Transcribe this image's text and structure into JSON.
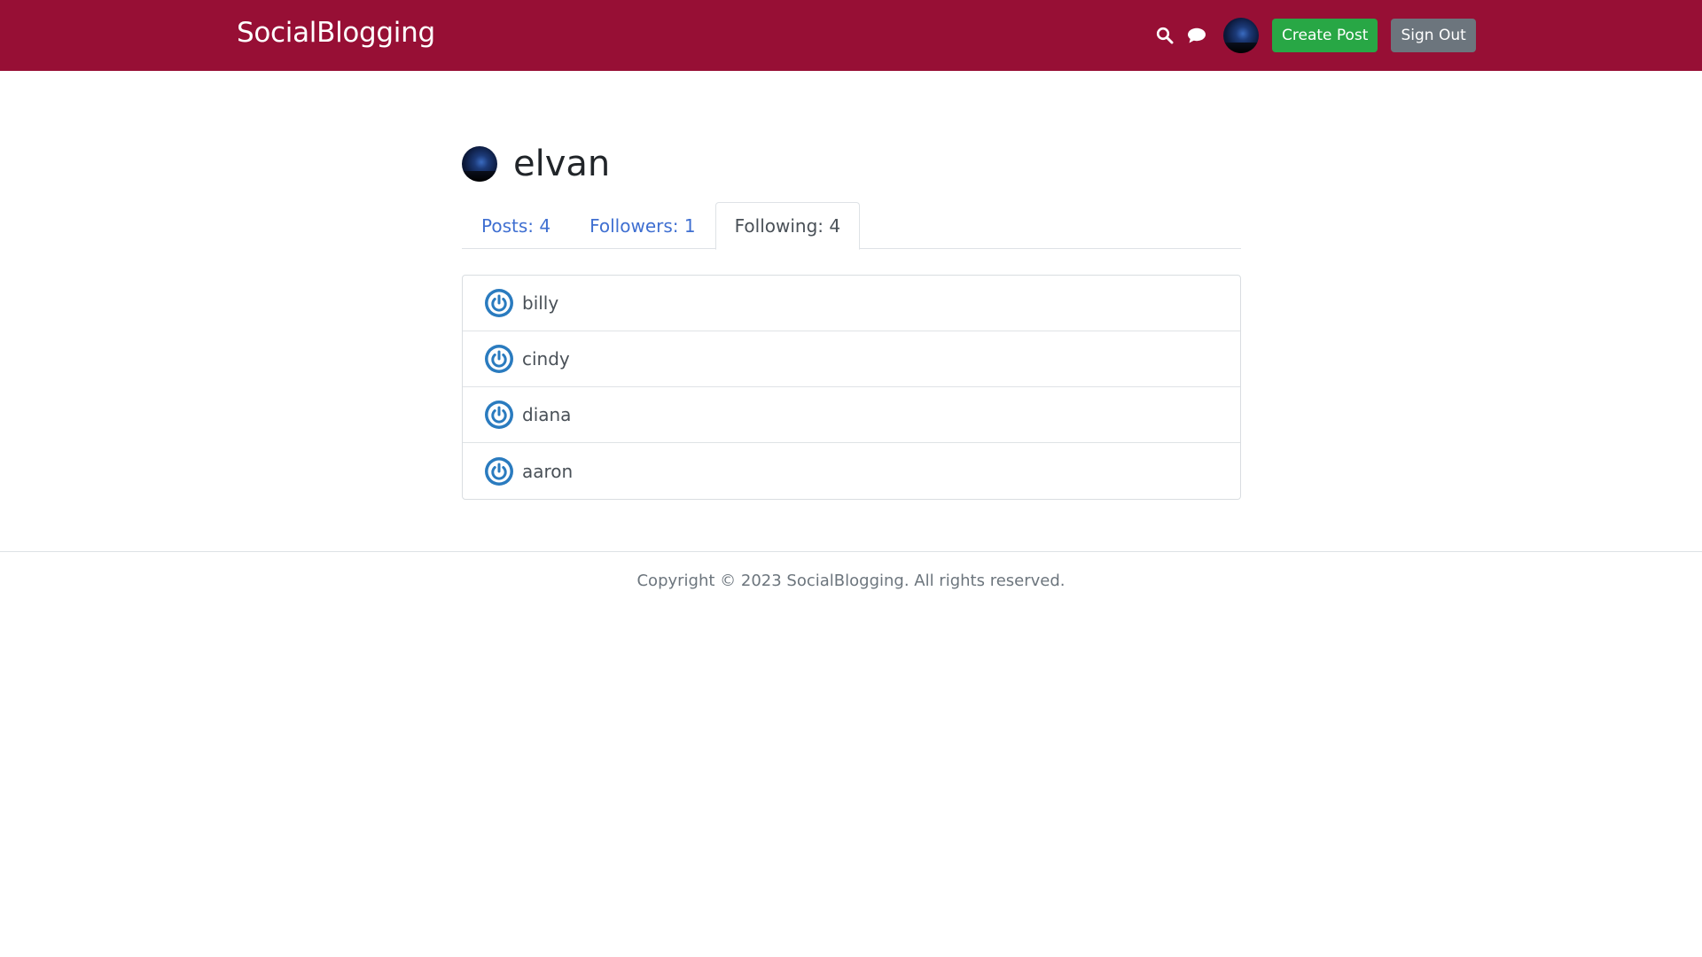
{
  "header": {
    "brand": "SocialBlogging",
    "icons": [
      "search-icon",
      "chat-icon"
    ],
    "create_post_label": "Create Post",
    "sign_out_label": "Sign Out"
  },
  "profile": {
    "username": "elvan",
    "tabs": [
      {
        "label": "Posts: 4",
        "active": false
      },
      {
        "label": "Followers: 1",
        "active": false
      },
      {
        "label": "Following: 4",
        "active": true
      }
    ],
    "following": [
      {
        "name": "billy",
        "icon": "power-icon"
      },
      {
        "name": "cindy",
        "icon": "power-icon"
      },
      {
        "name": "diana",
        "icon": "power-icon"
      },
      {
        "name": "aaron",
        "icon": "power-icon"
      }
    ]
  },
  "footer": {
    "copyright": "Copyright © 2023 SocialBlogging. All rights reserved."
  },
  "colors": {
    "navbar": "#970f35",
    "create_button": "#28a745",
    "sign_out_button": "#6c757d",
    "link": "#3f6fd1",
    "follow_icon": "#2a7bbf"
  }
}
